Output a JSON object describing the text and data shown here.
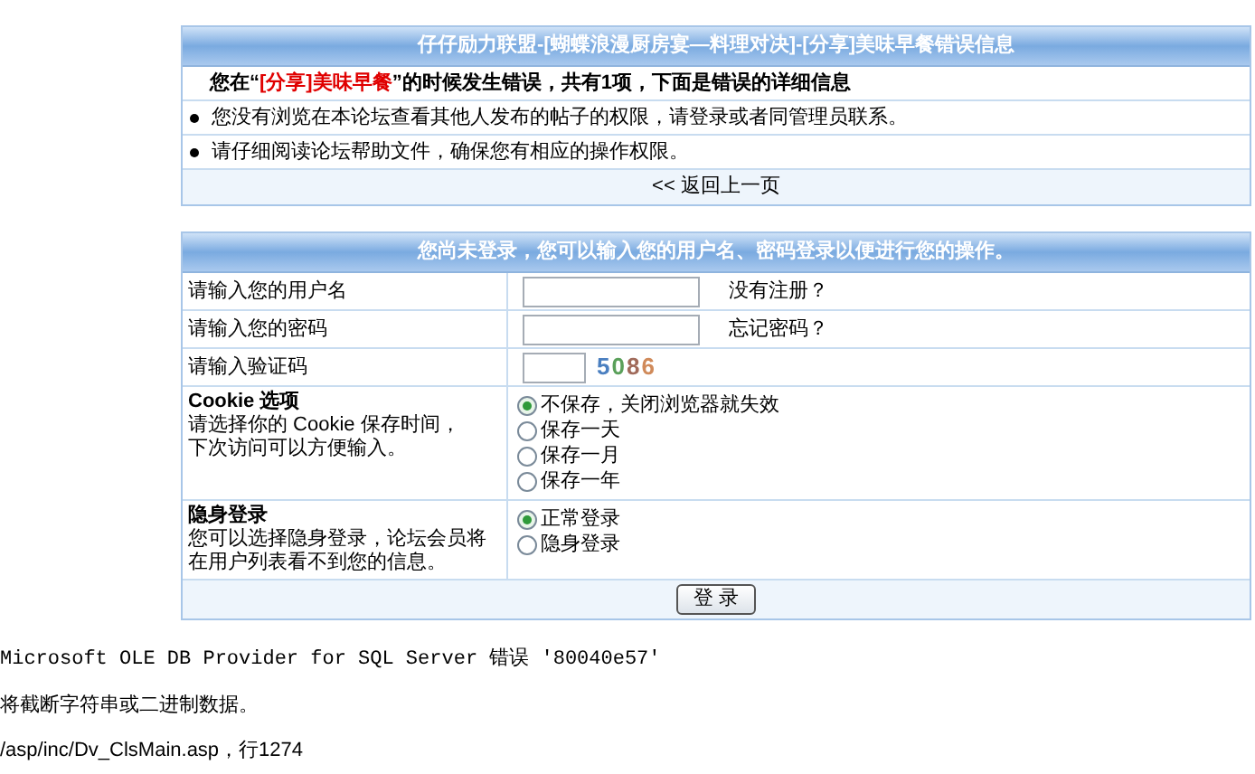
{
  "error_panel": {
    "title": "仔仔励力联盟-[蝴蝶浪漫厨房宴—料理对决]-[分享]美味早餐错误信息",
    "summary": "您在“**[分享]美味早餐**”的时候发生错误，共有1项，下面是错误的详细信息",
    "bullets": [
      "您没有浏览在本论坛查看其他人发布的帖子的权限，请登录或者同管理员联系。",
      "请仔细阅读论坛帮助文件，确保您有相应的操作权限。"
    ],
    "back_link": "<< 返回上一页"
  },
  "login_panel": {
    "title": "您尚未登录，您可以输入您的用户名、密码登录以便进行您的操作。",
    "fields": [
      {
        "label": "请输入您的用户名",
        "kind": "text",
        "link": "没有注册？"
      },
      {
        "label": "请输入您的密码",
        "kind": "password",
        "link": "忘记密码？"
      },
      {
        "label": "请输入验证码",
        "kind": "captcha",
        "captcha": [
          {
            "char": "5",
            "color": "#4a7fc0"
          },
          {
            "char": "0",
            "color": "#5aa05a"
          },
          {
            "char": "8",
            "color": "#a06a5a"
          },
          {
            "char": "6",
            "color": "#d08a5a"
          }
        ]
      }
    ],
    "options": [
      {
        "title": "Cookie 选项",
        "description": [
          "请选择你的 Cookie 保存时间，",
          "下次访问可以方便输入。"
        ],
        "choices": [
          {
            "label": "不保存，关闭浏览器就失效",
            "selected": true
          },
          {
            "label": "保存一天",
            "selected": false
          },
          {
            "label": "保存一月",
            "selected": false
          },
          {
            "label": "保存一年",
            "selected": false
          }
        ]
      },
      {
        "title": "隐身登录",
        "description": [
          "您可以选择隐身登录，论坛会员将在用户列表看不到您的信息。"
        ],
        "choices": [
          {
            "label": "正常登录",
            "selected": true
          },
          {
            "label": "隐身登录",
            "selected": false
          }
        ]
      }
    ],
    "submit": "登 录"
  },
  "error_output": [
    {
      "kind": "mono",
      "text": "Microsoft OLE DB Provider for SQL Server 错误 '80040e57'"
    },
    {
      "kind": "plain",
      "text": "将截断字符串或二进制数据。"
    },
    {
      "kind": "plain",
      "text": "/asp/inc/Dv_ClsMain.asp，行1274"
    }
  ]
}
